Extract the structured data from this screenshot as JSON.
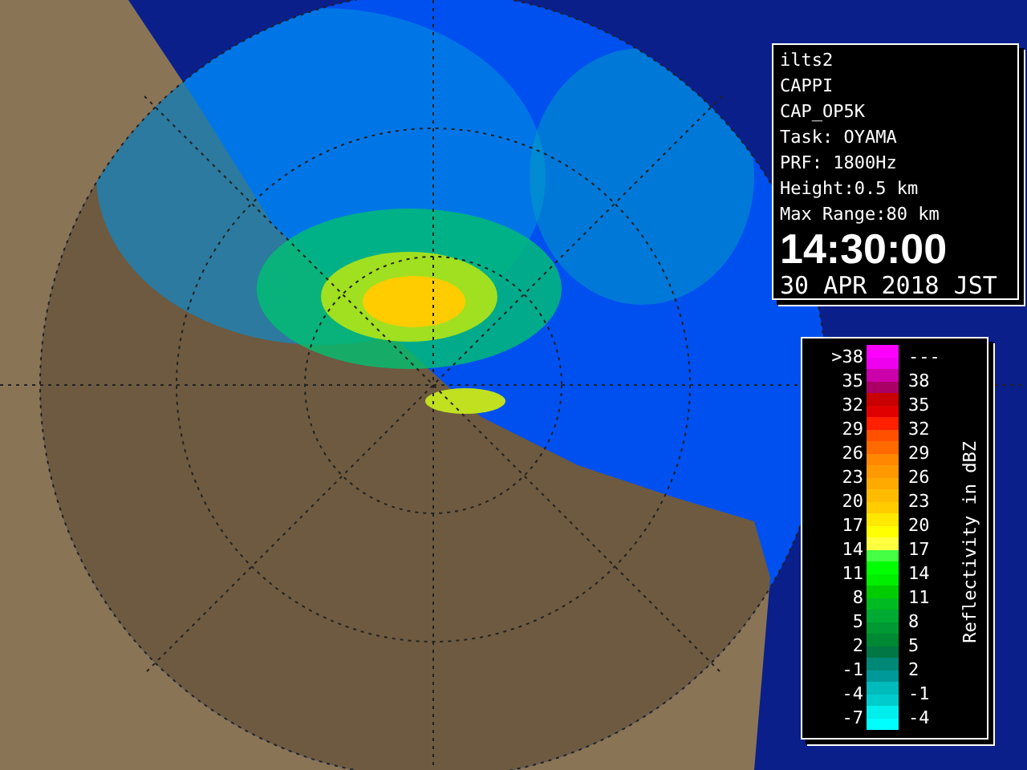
{
  "info_panel": {
    "lines": [
      "ilts2",
      "CAPPI",
      "CAP_OP5K",
      "Task: OYAMA",
      "PRF: 1800Hz",
      "Height:0.5 km",
      "Max Range:80 km"
    ],
    "time": "14:30:00",
    "date": "30 APR 2018 JST"
  },
  "legend": {
    "title": "Reflectivity in dBZ",
    "rows": [
      {
        "low": ">38",
        "high": "---",
        "swatches": [
          {
            "color": "#ff00ff"
          },
          {
            "color": "#ee00ee"
          }
        ]
      },
      {
        "low": "35",
        "high": "38",
        "swatches": [
          {
            "color": "#cc00aa"
          },
          {
            "color": "#aa0066"
          }
        ]
      },
      {
        "low": "32",
        "high": "35",
        "swatches": [
          {
            "color": "#c80000"
          },
          {
            "color": "#e00000"
          }
        ]
      },
      {
        "low": "29",
        "high": "32",
        "swatches": [
          {
            "color": "#ff2000"
          },
          {
            "color": "#ff5000"
          }
        ]
      },
      {
        "low": "26",
        "high": "29",
        "swatches": [
          {
            "color": "#ff6a00"
          },
          {
            "color": "#ff8800"
          }
        ]
      },
      {
        "low": "23",
        "high": "26",
        "swatches": [
          {
            "color": "#ff9900"
          },
          {
            "color": "#ffaa00"
          }
        ]
      },
      {
        "low": "20",
        "high": "23",
        "swatches": [
          {
            "color": "#ffbb00"
          },
          {
            "color": "#ffcc00"
          }
        ]
      },
      {
        "low": "17",
        "high": "20",
        "swatches": [
          {
            "color": "#ffe800"
          },
          {
            "color": "#ffff00"
          }
        ]
      },
      {
        "low": "14",
        "high": "17",
        "swatches": [
          {
            "color": "#ffff40"
          },
          {
            "color": "#44ff44"
          }
        ]
      },
      {
        "low": "11",
        "high": "14",
        "swatches": [
          {
            "color": "#00ff00"
          },
          {
            "color": "#00ee00"
          }
        ]
      },
      {
        "low": "8",
        "high": "11",
        "swatches": [
          {
            "color": "#00cc00"
          },
          {
            "color": "#00bb22"
          }
        ]
      },
      {
        "low": "5",
        "high": "8",
        "swatches": [
          {
            "color": "#00aa33"
          },
          {
            "color": "#009933"
          }
        ]
      },
      {
        "low": "2",
        "high": "5",
        "swatches": [
          {
            "color": "#008833"
          },
          {
            "color": "#007744"
          }
        ]
      },
      {
        "low": "-1",
        "high": "2",
        "swatches": [
          {
            "color": "#008877"
          },
          {
            "color": "#009999"
          }
        ]
      },
      {
        "low": "-4",
        "high": "-1",
        "swatches": [
          {
            "color": "#00bbbb"
          },
          {
            "color": "#00cccc"
          }
        ]
      },
      {
        "low": "-7",
        "high": "-4",
        "swatches": [
          {
            "color": "#00eeee"
          },
          {
            "color": "#00ffff"
          }
        ]
      }
    ]
  }
}
